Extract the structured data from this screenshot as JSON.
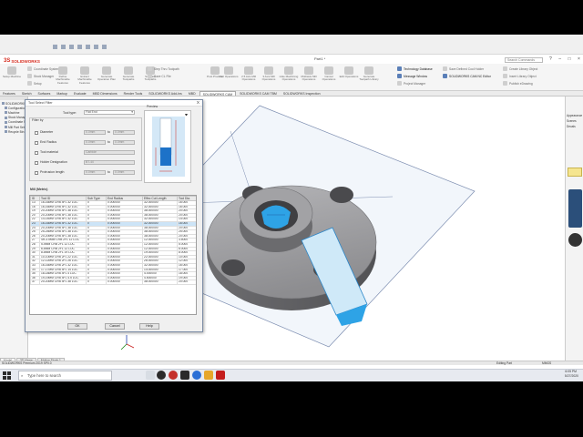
{
  "app": {
    "logo_text": "SOLIDWORKS",
    "document_title": "Part1 *",
    "search_placeholder": "Search Commands"
  },
  "ribbon": {
    "left_buttons": [
      "Setup Machine",
      "Define Machinable Features",
      "Extract Machinable Features",
      "Generate Operation Plan",
      "Generate Toolpaths",
      "Simulate Toolpaths",
      "Step Thru Toolpath",
      "Save CL File",
      "Post Process",
      "Part Operations",
      "2.5 Axis Mill Operations",
      "3 Axis Mill Operations",
      "Hole Machining Operations",
      "Multiaxis Mill Operations",
      "Cancel Operations",
      "Edit Operations",
      "Generate Toolpath Library"
    ],
    "small_tools": [
      "Coordinate System",
      "Stock Manager",
      "Setup"
    ],
    "tech_db": "Technology Database",
    "msg_window": "Message Window",
    "proj_mgr": "Project Manager",
    "right_options": [
      "Save Defined Cool Holder",
      "Save Data",
      "Publish eDrawings",
      "SOLIDWORKS CAM NC Editor",
      "Create Library Object",
      "Insert Library Object",
      "Publish eDrawing"
    ]
  },
  "cmtabs": [
    "Features",
    "Sketch",
    "Surfaces",
    "Markup",
    "Evaluate",
    "MBD Dimensions",
    "Render Tools",
    "SOLIDWORKS Add-Ins",
    "MBD",
    "SOLIDWORKS CAM",
    "SOLIDWORKS CAM TBM",
    "SOLIDWORKS Inspection"
  ],
  "active_cmtab": "SOLIDWORKS CAM",
  "fmtree": [
    "SOLIDWORKS CAM",
    "Configurations",
    "Machine",
    "Stock Manager",
    "Coordinate System",
    "Mill Part Setup",
    "Recycle Bin"
  ],
  "dialog": {
    "title": "Tool Select Filter",
    "close": "X",
    "tool_type_label": "Tool type:",
    "tool_type_value": "Flat End",
    "preview_label": "Preview",
    "filter_by": "Filter by",
    "filters": [
      {
        "label": "Diameter",
        "min": "0.0mm",
        "max": "0.0mm",
        "checked": false
      },
      {
        "label": "End Radius",
        "min": "0.0mm",
        "max": "0.0mm",
        "checked": false
      },
      {
        "label": "Tool material",
        "value": "Carbide",
        "checked": false
      },
      {
        "label": "Holder Designation",
        "value": "BT-40",
        "checked": false
      },
      {
        "label": "Protrusion length",
        "min": "0.0mm",
        "max": "0.0mm",
        "checked": false
      }
    ],
    "to_label": "to",
    "table_title": "Mill (Metric)",
    "columns": [
      "ID",
      "Tool ID",
      "Sub Type",
      "End Radius",
      "Effec Cut Length",
      "Tool Dia."
    ],
    "rows": [
      [
        "13",
        "16-16MM CRB 4FL 32 LOC",
        "0",
        "0.000000",
        "32.000000",
        "16.000"
      ],
      [
        "16",
        "16-16MM CRB 4FL 32 LOC",
        "0",
        "0.000000",
        "32.000000",
        "16.000"
      ],
      [
        "19",
        "20-20MM CRB 4FL 38 LOC",
        "0",
        "0.000000",
        "38.000000",
        "20.000"
      ],
      [
        "20",
        "20-20MM CRB 4FL 38 LOC",
        "0",
        "0.000000",
        "38.000000",
        "20.000"
      ],
      [
        "22",
        "14-14MM CRB 4FL 32 LOC",
        "0",
        "0.000000",
        "32.000000",
        "14.000"
      ],
      [
        "23",
        "16-16MM CRB 4FL 32 LOC",
        "0",
        "0.000000",
        "32.000000",
        "16.000"
      ],
      [
        "24",
        "20-20MM CRB 4FL 38 LOC",
        "0",
        "0.000000",
        "38.000000",
        "20.000"
      ],
      [
        "25",
        "25-25MM CRB 4FL 38 LOC",
        "0",
        "0.000000",
        "38.000000",
        "25.000"
      ],
      [
        "26",
        "20-20MM CRB 4FL 38 LOC",
        "0",
        "0.000000",
        "38.000000",
        "20.000"
      ],
      [
        "27",
        "4R-3.5MM CRB 2FL 12 LOC",
        "0",
        "0.000000",
        "12.000000",
        "3.5000"
      ],
      [
        "28",
        "5-5MM CRB 2FL 12 LOC",
        "0",
        "0.000000",
        "12.000000",
        "5.0000"
      ],
      [
        "29",
        "6-6MM CRB 2FL 12 LOC",
        "0",
        "0.000000",
        "12.000000",
        "6.0000"
      ],
      [
        "30",
        "8-8MM CRB 2FL 19 LOC",
        "0",
        "0.000000",
        "19.000000",
        "8.0000"
      ],
      [
        "31",
        "10-10MM CRB 2FL 22 LOC",
        "0",
        "0.000000",
        "22.000000",
        "10.000"
      ],
      [
        "32",
        "12-12MM CRB 2FL 26 LOC",
        "0",
        "0.000000",
        "26.000000",
        "12.000"
      ],
      [
        "33",
        "16-16MM CRB 2FL 32 LOC",
        "0",
        "0.000000",
        "32.000000",
        "16.000"
      ],
      [
        "34",
        "17-17MM CRB 4FL 14 LOC",
        "0",
        "0.000000",
        "14.000000",
        "17.000"
      ],
      [
        "35",
        "18-18MM CRB 4FL 4 LOC",
        "0",
        "0.000000",
        "4.000000",
        "18.000"
      ],
      [
        "36",
        "19-19MM CRB 4FL 4.5 LOC",
        "0",
        "0.000000",
        "4.500000",
        "19.000"
      ],
      [
        "37",
        "20-20MM CRB 4FL 38 LOC",
        "0",
        "0.000000",
        "38.000000",
        "20.000"
      ]
    ],
    "ok": "OK",
    "cancel": "Cancel",
    "help": "Help"
  },
  "bottom_tabs": [
    "Model",
    "3D Views",
    "Motion Study 1"
  ],
  "status": {
    "left": "SOLIDWORKS Premium 2019 SP0.0",
    "editing": "Editing Part",
    "units": "MMGS"
  },
  "taskbar": {
    "search_text": "Type here to search",
    "time": "6:05 PM",
    "date": "5/27/2020"
  },
  "taskpane": {
    "items": [
      "Appearances",
      "Scenes",
      "Decals"
    ]
  },
  "colors": {
    "accent_blue": "#2b7ad3",
    "selection_face": "#2ea3e6",
    "part_grey": "#8e8e91"
  }
}
